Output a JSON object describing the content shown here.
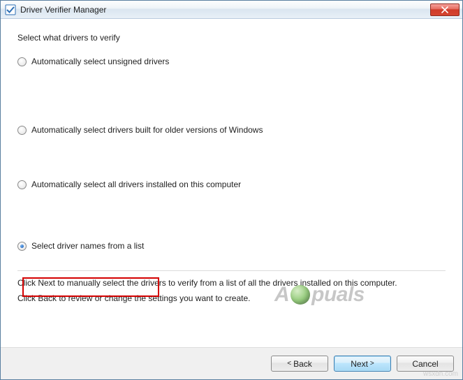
{
  "window": {
    "title": "Driver Verifier Manager"
  },
  "page": {
    "heading": "Select what drivers to verify",
    "options": [
      {
        "label": "Automatically select unsigned drivers",
        "checked": false
      },
      {
        "label": "Automatically select drivers built for older versions of Windows",
        "checked": false
      },
      {
        "label": "Automatically select all drivers installed on this computer",
        "checked": false
      },
      {
        "label": "Select driver names from a list",
        "checked": true
      }
    ],
    "hint1": "Click Next to manually select the drivers to verify from a list of all the drivers installed on this computer.",
    "hint2": "Click Back to review or change the settings you want to create."
  },
  "buttons": {
    "back": "Back",
    "next": "Next",
    "cancel": "Cancel"
  },
  "watermark": {
    "left": "A",
    "right": "puals"
  },
  "source": "wsxdn.com"
}
